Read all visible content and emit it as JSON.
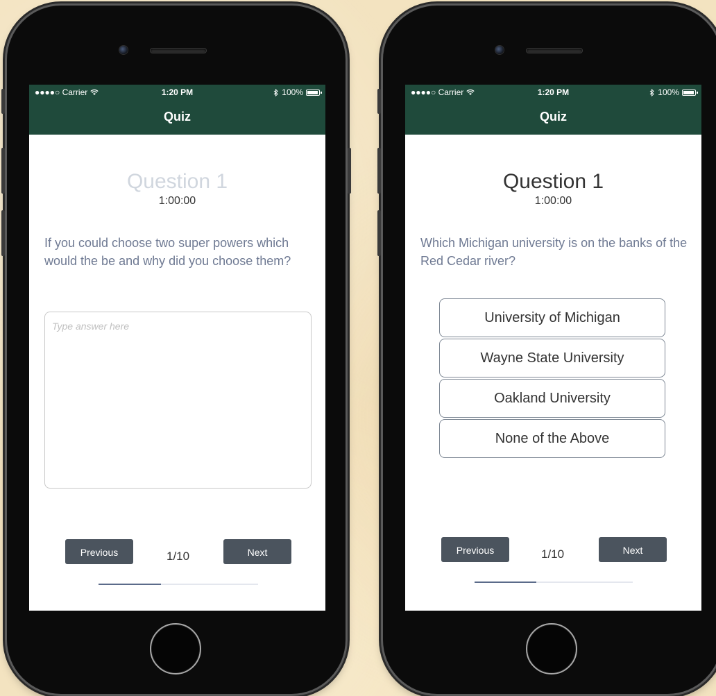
{
  "phones": [
    {
      "status": {
        "carrier": "●●●●○ Carrier",
        "wifi_icon": "wifi-icon",
        "time": "1:20 PM",
        "bluetooth_icon": "bluetooth-icon",
        "battery_pct": "100%",
        "battery_icon": "battery-icon"
      },
      "nav_title": "Quiz",
      "question_title": "Question 1",
      "timer": "1:00:00",
      "question_text": "If you could choose two super powers which would the be and why did you choose them?",
      "answer": {
        "placeholder": "Type answer here",
        "value": ""
      },
      "previous_label": "Previous",
      "next_label": "Next",
      "page_counter": "1/10",
      "progress_fraction": 0.1
    },
    {
      "status": {
        "carrier": "●●●●○ Carrier",
        "wifi_icon": "wifi-icon",
        "time": "1:20 PM",
        "bluetooth_icon": "bluetooth-icon",
        "battery_pct": "100%",
        "battery_icon": "battery-icon"
      },
      "nav_title": "Quiz",
      "question_title": "Question 1",
      "timer": "1:00:00",
      "question_text": "Which Michigan university is on the banks of the Red Cedar river?",
      "choices": [
        "University of Michigan",
        "Wayne State University",
        "Oakland University",
        "None of the Above"
      ],
      "previous_label": "Previous",
      "next_label": "Next",
      "page_counter": "1/10",
      "progress_fraction": 0.1
    }
  ],
  "colors": {
    "header": "#1f4a3b",
    "button": "#4b545e",
    "question_text": "#6f7a93",
    "question_title_left": "#d0d6de",
    "question_title_right": "#333333",
    "background": "#f3e3c0"
  }
}
